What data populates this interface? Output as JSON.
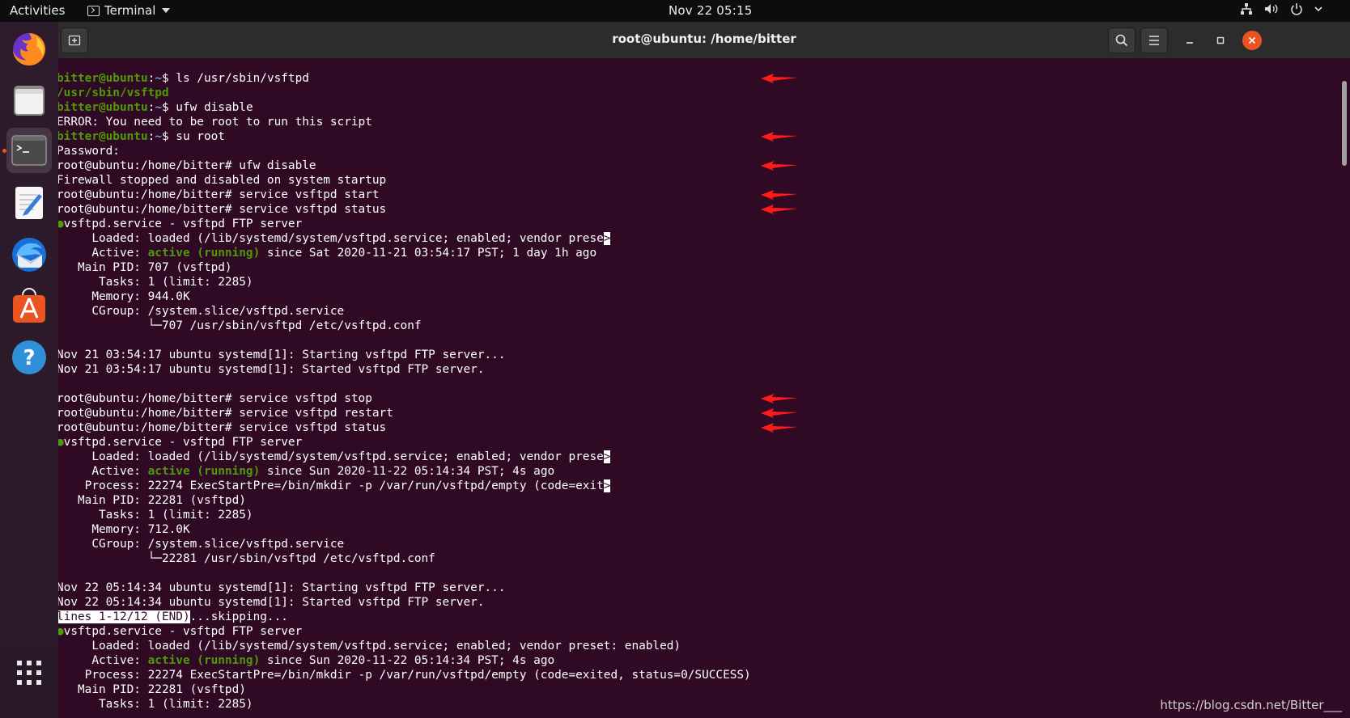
{
  "topbar": {
    "activities": "Activities",
    "app_menu": "Terminal",
    "clock": "Nov 22  05:15",
    "tray_icons": [
      "network-icon",
      "volume-icon",
      "power-icon"
    ]
  },
  "dock": {
    "items": [
      "firefox",
      "files",
      "terminal",
      "text-editor",
      "thunderbird",
      "software-center",
      "help"
    ],
    "show_apps": "show-apps-grid"
  },
  "window": {
    "title": "root@ubuntu: /home/bitter"
  },
  "terminal": {
    "colors": {
      "background": "#300a24",
      "user": "#4e9a06",
      "path": "#729fcf",
      "arrow": "#ff1a1a"
    },
    "lines": [
      [
        {
          "t": "bitter@ubuntu",
          "c": "g"
        },
        {
          "t": ":",
          "c": ""
        },
        {
          "t": "~",
          "c": "b"
        },
        {
          "t": "$ ls /usr/sbin/vsftpd",
          "c": ""
        }
      ],
      [
        {
          "t": "/usr/sbin/vsftpd",
          "c": "g"
        }
      ],
      [
        {
          "t": "bitter@ubuntu",
          "c": "g"
        },
        {
          "t": ":",
          "c": ""
        },
        {
          "t": "~",
          "c": "b"
        },
        {
          "t": "$ ufw disable",
          "c": ""
        }
      ],
      [
        {
          "t": "ERROR: You need to be root to run this script",
          "c": ""
        }
      ],
      [
        {
          "t": "bitter@ubuntu",
          "c": "g"
        },
        {
          "t": ":",
          "c": ""
        },
        {
          "t": "~",
          "c": "b"
        },
        {
          "t": "$ su root",
          "c": ""
        }
      ],
      [
        {
          "t": "Password:",
          "c": ""
        }
      ],
      [
        {
          "t": "root@ubuntu:/home/bitter# ufw disable",
          "c": ""
        }
      ],
      [
        {
          "t": "Firewall stopped and disabled on system startup",
          "c": ""
        }
      ],
      [
        {
          "t": "root@ubuntu:/home/bitter# service vsftpd start",
          "c": ""
        }
      ],
      [
        {
          "t": "root@ubuntu:/home/bitter# service vsftpd status",
          "c": ""
        }
      ],
      [
        {
          "t": "●",
          "c": "dot"
        },
        {
          "t": "vsftpd.service - vsftpd FTP server",
          "c": ""
        }
      ],
      [
        {
          "t": "     Loaded: loaded (/lib/systemd/system/vsftpd.service; enabled; vendor prese",
          "c": ""
        },
        {
          "t": ">",
          "c": "hl"
        }
      ],
      [
        {
          "t": "     Active: ",
          "c": ""
        },
        {
          "t": "active (running)",
          "c": "grn"
        },
        {
          "t": " since Sat 2020-11-21 03:54:17 PST; 1 day 1h ago",
          "c": ""
        }
      ],
      [
        {
          "t": "   Main PID: 707 (vsftpd)",
          "c": ""
        }
      ],
      [
        {
          "t": "      Tasks: 1 (limit: 2285)",
          "c": ""
        }
      ],
      [
        {
          "t": "     Memory: 944.0K",
          "c": ""
        }
      ],
      [
        {
          "t": "     CGroup: /system.slice/vsftpd.service",
          "c": ""
        }
      ],
      [
        {
          "t": "             └─707 /usr/sbin/vsftpd /etc/vsftpd.conf",
          "c": ""
        }
      ],
      [
        {
          "t": "",
          "c": ""
        }
      ],
      [
        {
          "t": "Nov 21 03:54:17 ubuntu systemd[1]: Starting vsftpd FTP server...",
          "c": ""
        }
      ],
      [
        {
          "t": "Nov 21 03:54:17 ubuntu systemd[1]: Started vsftpd FTP server.",
          "c": ""
        }
      ],
      [
        {
          "t": "",
          "c": ""
        }
      ],
      [
        {
          "t": "root@ubuntu:/home/bitter# service vsftpd stop",
          "c": ""
        }
      ],
      [
        {
          "t": "root@ubuntu:/home/bitter# service vsftpd restart",
          "c": ""
        }
      ],
      [
        {
          "t": "root@ubuntu:/home/bitter# service vsftpd status",
          "c": ""
        }
      ],
      [
        {
          "t": "●",
          "c": "dot"
        },
        {
          "t": "vsftpd.service - vsftpd FTP server",
          "c": ""
        }
      ],
      [
        {
          "t": "     Loaded: loaded (/lib/systemd/system/vsftpd.service; enabled; vendor prese",
          "c": ""
        },
        {
          "t": ">",
          "c": "hl"
        }
      ],
      [
        {
          "t": "     Active: ",
          "c": ""
        },
        {
          "t": "active (running)",
          "c": "grn"
        },
        {
          "t": " since Sun 2020-11-22 05:14:34 PST; 4s ago",
          "c": ""
        }
      ],
      [
        {
          "t": "    Process: 22274 ExecStartPre=/bin/mkdir -p /var/run/vsftpd/empty (code=exit",
          "c": ""
        },
        {
          "t": ">",
          "c": "hl"
        }
      ],
      [
        {
          "t": "   Main PID: 22281 (vsftpd)",
          "c": ""
        }
      ],
      [
        {
          "t": "      Tasks: 1 (limit: 2285)",
          "c": ""
        }
      ],
      [
        {
          "t": "     Memory: 712.0K",
          "c": ""
        }
      ],
      [
        {
          "t": "     CGroup: /system.slice/vsftpd.service",
          "c": ""
        }
      ],
      [
        {
          "t": "             └─22281 /usr/sbin/vsftpd /etc/vsftpd.conf",
          "c": ""
        }
      ],
      [
        {
          "t": "",
          "c": ""
        }
      ],
      [
        {
          "t": "Nov 22 05:14:34 ubuntu systemd[1]: Starting vsftpd FTP server...",
          "c": ""
        }
      ],
      [
        {
          "t": "Nov 22 05:14:34 ubuntu systemd[1]: Started vsftpd FTP server.",
          "c": ""
        }
      ],
      [
        {
          "t": "lines 1-12/12 (END)",
          "c": "hl"
        },
        {
          "t": "...skipping...",
          "c": ""
        }
      ],
      [
        {
          "t": "●",
          "c": "dot"
        },
        {
          "t": "vsftpd.service - vsftpd FTP server",
          "c": ""
        }
      ],
      [
        {
          "t": "     Loaded: loaded (/lib/systemd/system/vsftpd.service; enabled; vendor preset: enabled)",
          "c": ""
        }
      ],
      [
        {
          "t": "     Active: ",
          "c": ""
        },
        {
          "t": "active (running)",
          "c": "grn"
        },
        {
          "t": " since Sun 2020-11-22 05:14:34 PST; 4s ago",
          "c": ""
        }
      ],
      [
        {
          "t": "    Process: 22274 ExecStartPre=/bin/mkdir -p /var/run/vsftpd/empty (code=exited, status=0/SUCCESS)",
          "c": ""
        }
      ],
      [
        {
          "t": "   Main PID: 22281 (vsftpd)",
          "c": ""
        }
      ],
      [
        {
          "t": "      Tasks: 1 (limit: 2285)",
          "c": ""
        }
      ]
    ],
    "arrows_on_lines": [
      0,
      4,
      6,
      8,
      9,
      22,
      23,
      24
    ]
  },
  "watermark": "https://blog.csdn.net/Bitter___"
}
